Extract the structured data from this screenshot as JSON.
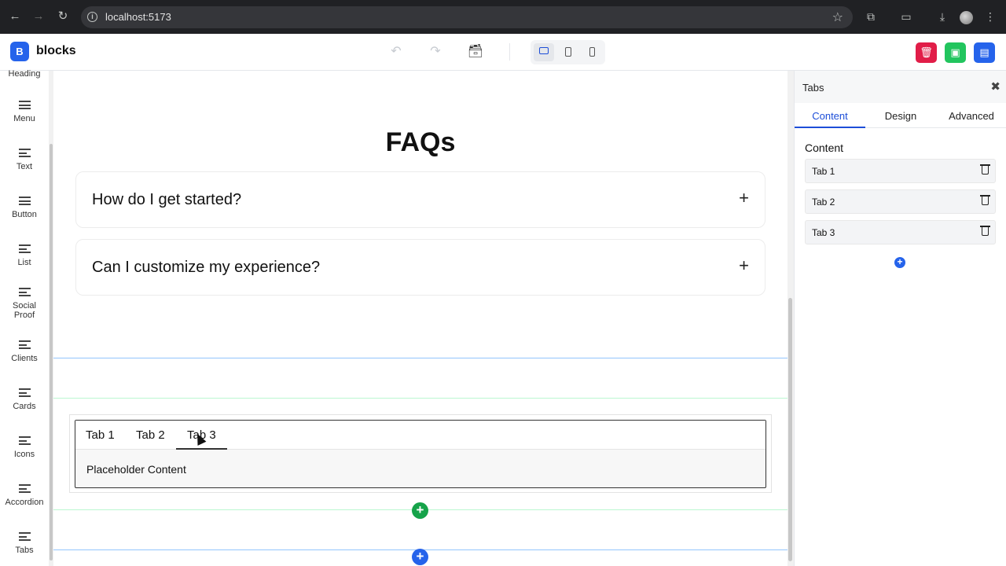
{
  "browser": {
    "url": "localhost:5173"
  },
  "app": {
    "logo_letter": "B",
    "name": "blocks"
  },
  "sidebar": {
    "items": [
      {
        "label": "Heading"
      },
      {
        "label": "Menu"
      },
      {
        "label": "Text"
      },
      {
        "label": "Button"
      },
      {
        "label": "List"
      },
      {
        "label": "Social Proof"
      },
      {
        "label": "Clients"
      },
      {
        "label": "Cards"
      },
      {
        "label": "Icons"
      },
      {
        "label": "Accordion"
      },
      {
        "label": "Tabs"
      }
    ]
  },
  "canvas": {
    "faq_title": "FAQs",
    "faqs": [
      {
        "question": "How do I get started?"
      },
      {
        "question": "Can I customize my experience?"
      }
    ],
    "tabs_block": {
      "tabs": [
        "Tab 1",
        "Tab 2",
        "Tab 3"
      ],
      "active_tab": "Tab 3",
      "content": "Placeholder Content"
    }
  },
  "panel": {
    "title": "Tabs",
    "tabs": [
      "Content",
      "Design",
      "Advanced"
    ],
    "active_tab": "Content",
    "section_title": "Content",
    "items": [
      {
        "label": "Tab 1"
      },
      {
        "label": "Tab 2"
      },
      {
        "label": "Tab 3"
      }
    ]
  },
  "colors": {
    "accent_blue": "#2563eb",
    "delete_red": "#e11d48",
    "save_green": "#22c55e",
    "add_green": "#16a34a"
  }
}
